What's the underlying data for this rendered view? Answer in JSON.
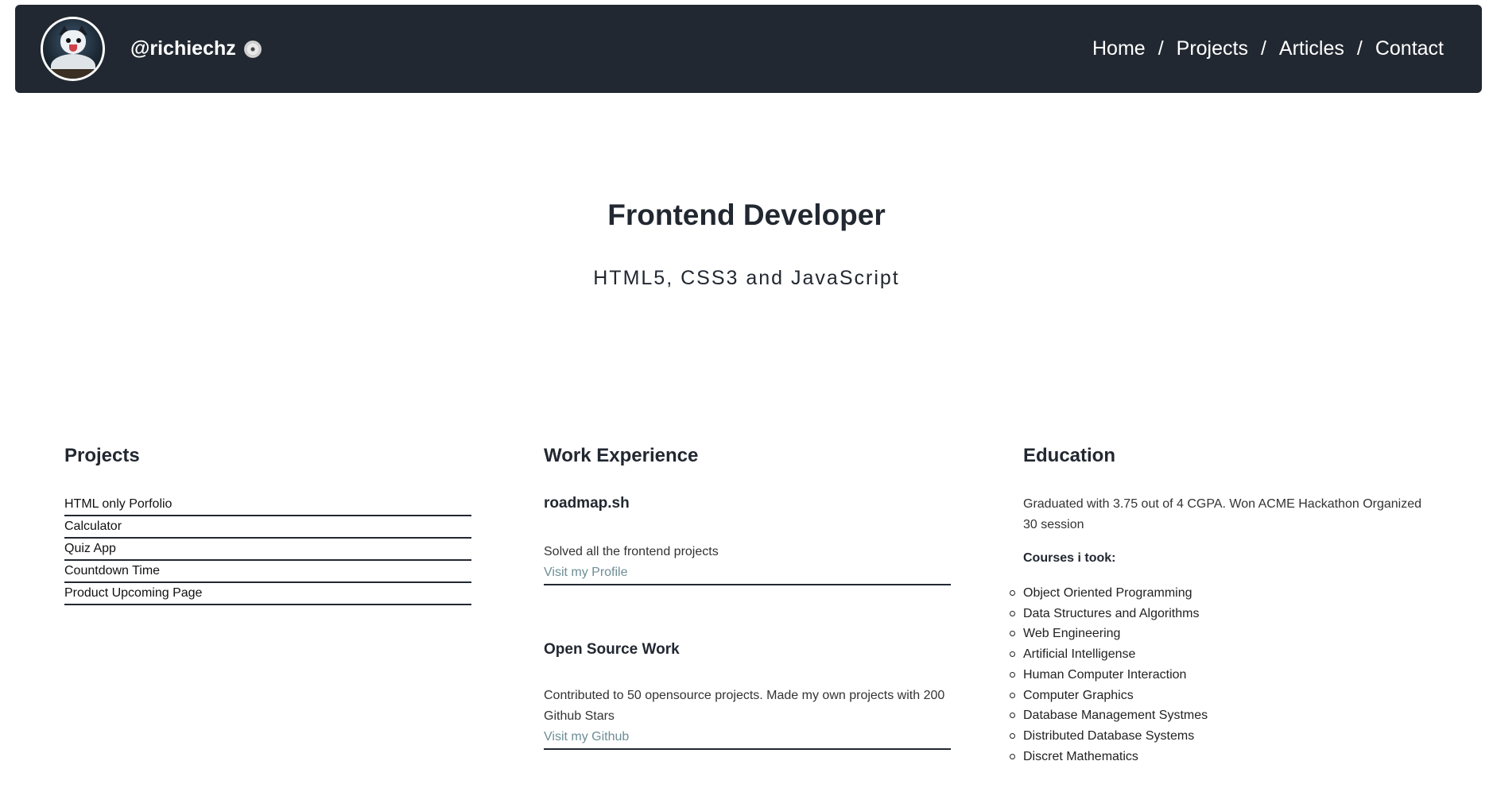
{
  "header": {
    "handle": "@richiechz",
    "nav": [
      {
        "label": "Home"
      },
      {
        "label": "Projects"
      },
      {
        "label": "Articles"
      },
      {
        "label": "Contact"
      }
    ],
    "separator": "/"
  },
  "hero": {
    "title": "Frontend Developer",
    "subtitle": "HTML5, CSS3 and JavaScript"
  },
  "projects": {
    "heading": "Projects",
    "items": [
      "HTML only Porfolio",
      "Calculator",
      "Quiz App",
      "Countdown Time",
      "Product Upcoming Page"
    ]
  },
  "work": {
    "heading": "Work Experience",
    "jobs": [
      {
        "title": "roadmap.sh",
        "description": "Solved all the frontend projects",
        "link": "Visit my Profile"
      },
      {
        "title": "Open Source Work",
        "description": "Contributed to 50 opensource projects. Made my own projects with 200 Github Stars",
        "link": "Visit my Github"
      }
    ]
  },
  "education": {
    "heading": "Education",
    "summary": "Graduated with 3.75 out of 4 CGPA. Won ACME Hackathon Organized 30 session",
    "courses_title": "Courses i took:",
    "courses": [
      "Object Oriented Programming",
      "Data Structures and Algorithms",
      "Web Engineering",
      "Artificial Intelligense",
      "Human Computer Interaction",
      "Computer Graphics",
      "Database Management Systmes",
      "Distributed Database Systems",
      "Discret Mathematics"
    ]
  },
  "colors": {
    "navbar_bg": "#222831",
    "link": "#6d8e96",
    "text": "#222831"
  },
  "icons": {
    "avatar": "cat-avatar",
    "handle_badge": "disc-icon"
  }
}
